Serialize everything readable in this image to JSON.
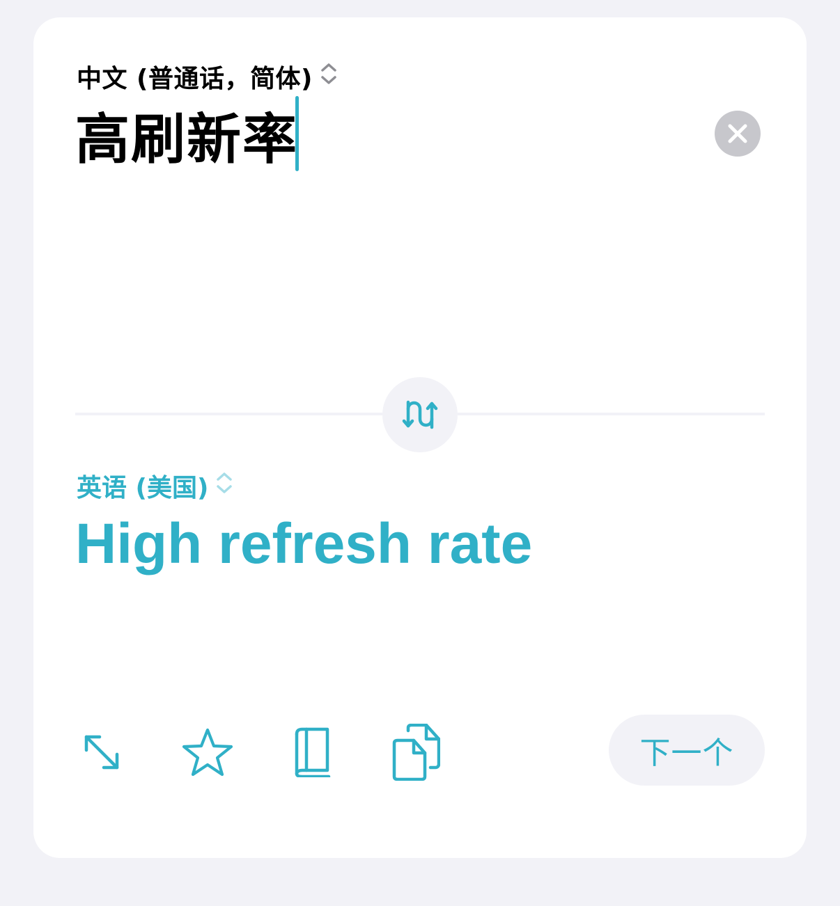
{
  "colors": {
    "accent": "#30b0c7",
    "accent_light": "#a6dde8",
    "clear_button": "#c7c7cc",
    "chevron_gray": "#8e8e93"
  },
  "source": {
    "language": "中文 (普通话，简体)",
    "text": "高刷新率",
    "language_chevron_icon": "chevron-up-down-icon",
    "clear_icon": "xmark-circle-icon"
  },
  "swap": {
    "icon": "arrow-swap-icon"
  },
  "target": {
    "language": "英语 (美国)",
    "text": "High refresh rate",
    "language_chevron_icon": "chevron-up-down-icon"
  },
  "actions": {
    "expand_icon": "expand-arrows-icon",
    "favorite_icon": "star-icon",
    "dictionary_icon": "book-icon",
    "copy_icon": "copy-icon",
    "next_label": "下一个"
  }
}
